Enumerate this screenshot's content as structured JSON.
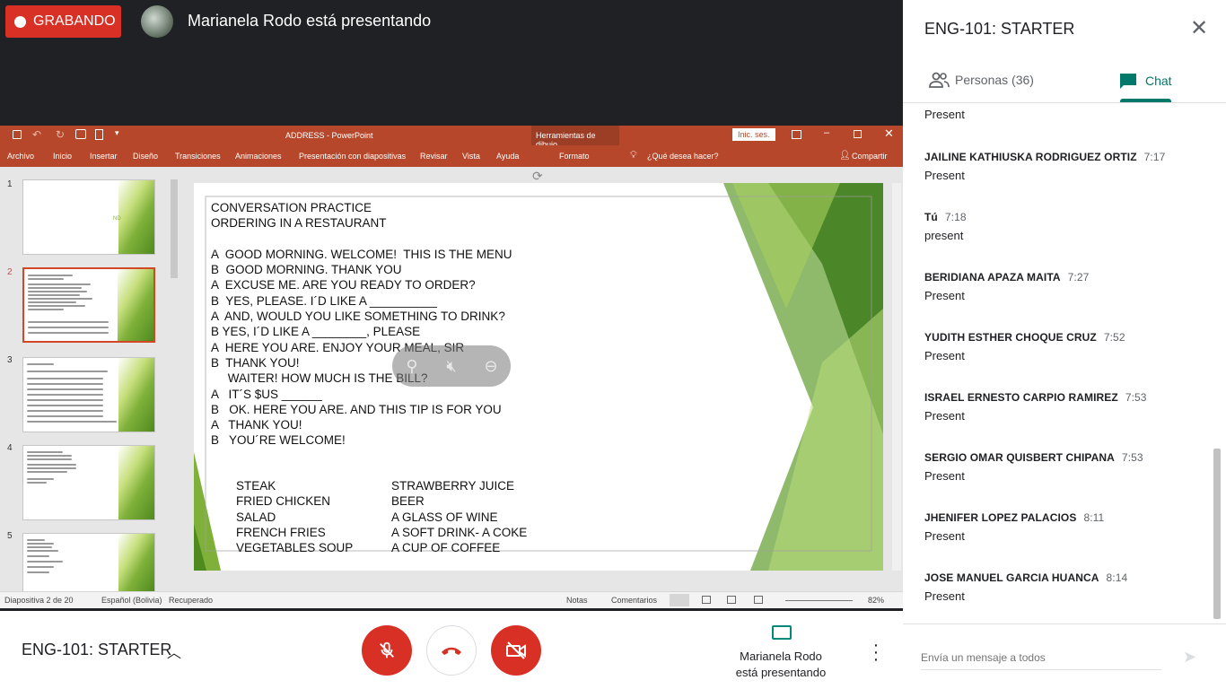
{
  "topbar": {
    "recording_label": "GRABANDO",
    "presenter_text": "Marianela Rodo está presentando"
  },
  "ppt": {
    "title": "ADDRESS  -  PowerPoint",
    "drawing_tools": "Herramientas de dibujo",
    "signin": "Inic. ses.",
    "tabs": [
      "Archivo",
      "Inicio",
      "Insertar",
      "Diseño",
      "Transiciones",
      "Animaciones",
      "Presentación con diapositivas",
      "Revisar",
      "Vista",
      "Ayuda",
      "Formato"
    ],
    "tell_me": "¿Qué desea hacer?",
    "share": "Compartir",
    "slide_numbers": [
      "1",
      "2",
      "3",
      "4",
      "5"
    ],
    "thumb1_text": "ND",
    "status": {
      "slide": "Diapositiva 2 de 20",
      "language": "Español (Bolivia)",
      "recovered": "Recuperado",
      "notes": "Notas",
      "comments": "Comentarios",
      "zoom": "82%"
    },
    "slide": {
      "lines": [
        "CONVERSATION PRACTICE",
        "ORDERING IN A RESTAURANT",
        "",
        "A  GOOD MORNING. WELCOME!  THIS IS THE MENU",
        "B  GOOD MORNING. THANK YOU",
        "A  EXCUSE ME. ARE YOU READY TO ORDER?",
        "B  YES, PLEASE. I´D LIKE A __________",
        "A  AND, WOULD YOU LIKE SOMETHING TO DRINK?",
        "B YES, I´D LIKE A ________, PLEASE",
        "A  HERE YOU ARE. ENJOY YOUR MEAL, SIR",
        "B  THANK YOU!",
        "     WAITER! HOW MUCH IS THE BILL?",
        "A   IT´S $US ______",
        "B   OK. HERE YOU ARE. AND THIS TIP IS FOR YOU",
        "A   THANK YOU!",
        "B   YOU´RE WELCOME!"
      ],
      "menu_food": [
        "STEAK",
        "FRIED CHICKEN",
        "SALAD",
        "FRENCH FRIES",
        "VEGETABLES SOUP"
      ],
      "menu_drinks": [
        "STRAWBERRY JUICE",
        "BEER",
        "A GLASS OF WINE",
        "A SOFT DRINK- A COKE",
        "A CUP OF COFFEE"
      ]
    }
  },
  "bottom": {
    "meeting_name": "ENG-101: STARTER",
    "presenter_line1": "Marianela Rodo",
    "presenter_line2": "está presentando"
  },
  "panel": {
    "title": "ENG-101: STARTER",
    "people_tab": "Personas (36)",
    "chat_tab": "Chat",
    "top_partial_text": "Present",
    "messages": [
      {
        "who": "JAILINE KATHIUSKA RODRIGUEZ ORTIZ",
        "time": "7:17",
        "text": "Present"
      },
      {
        "who": "Tú",
        "time": "7:18",
        "text": "present"
      },
      {
        "who": "BERIDIANA APAZA MAITA",
        "time": "7:27",
        "text": "Present"
      },
      {
        "who": "YUDITH ESTHER CHOQUE CRUZ",
        "time": "7:52",
        "text": "Present"
      },
      {
        "who": "ISRAEL ERNESTO CARPIO RAMIREZ",
        "time": "7:53",
        "text": "Present"
      },
      {
        "who": "SERGIO OMAR QUISBERT CHIPANA",
        "time": "7:53",
        "text": "Present"
      },
      {
        "who": "JHENIFER LOPEZ PALACIOS",
        "time": "8:11",
        "text": "Present"
      },
      {
        "who": "JOSE MANUEL GARCIA HUANCA",
        "time": "8:14",
        "text": "Present"
      }
    ],
    "compose_placeholder": "Envía un mensaje a todos"
  }
}
